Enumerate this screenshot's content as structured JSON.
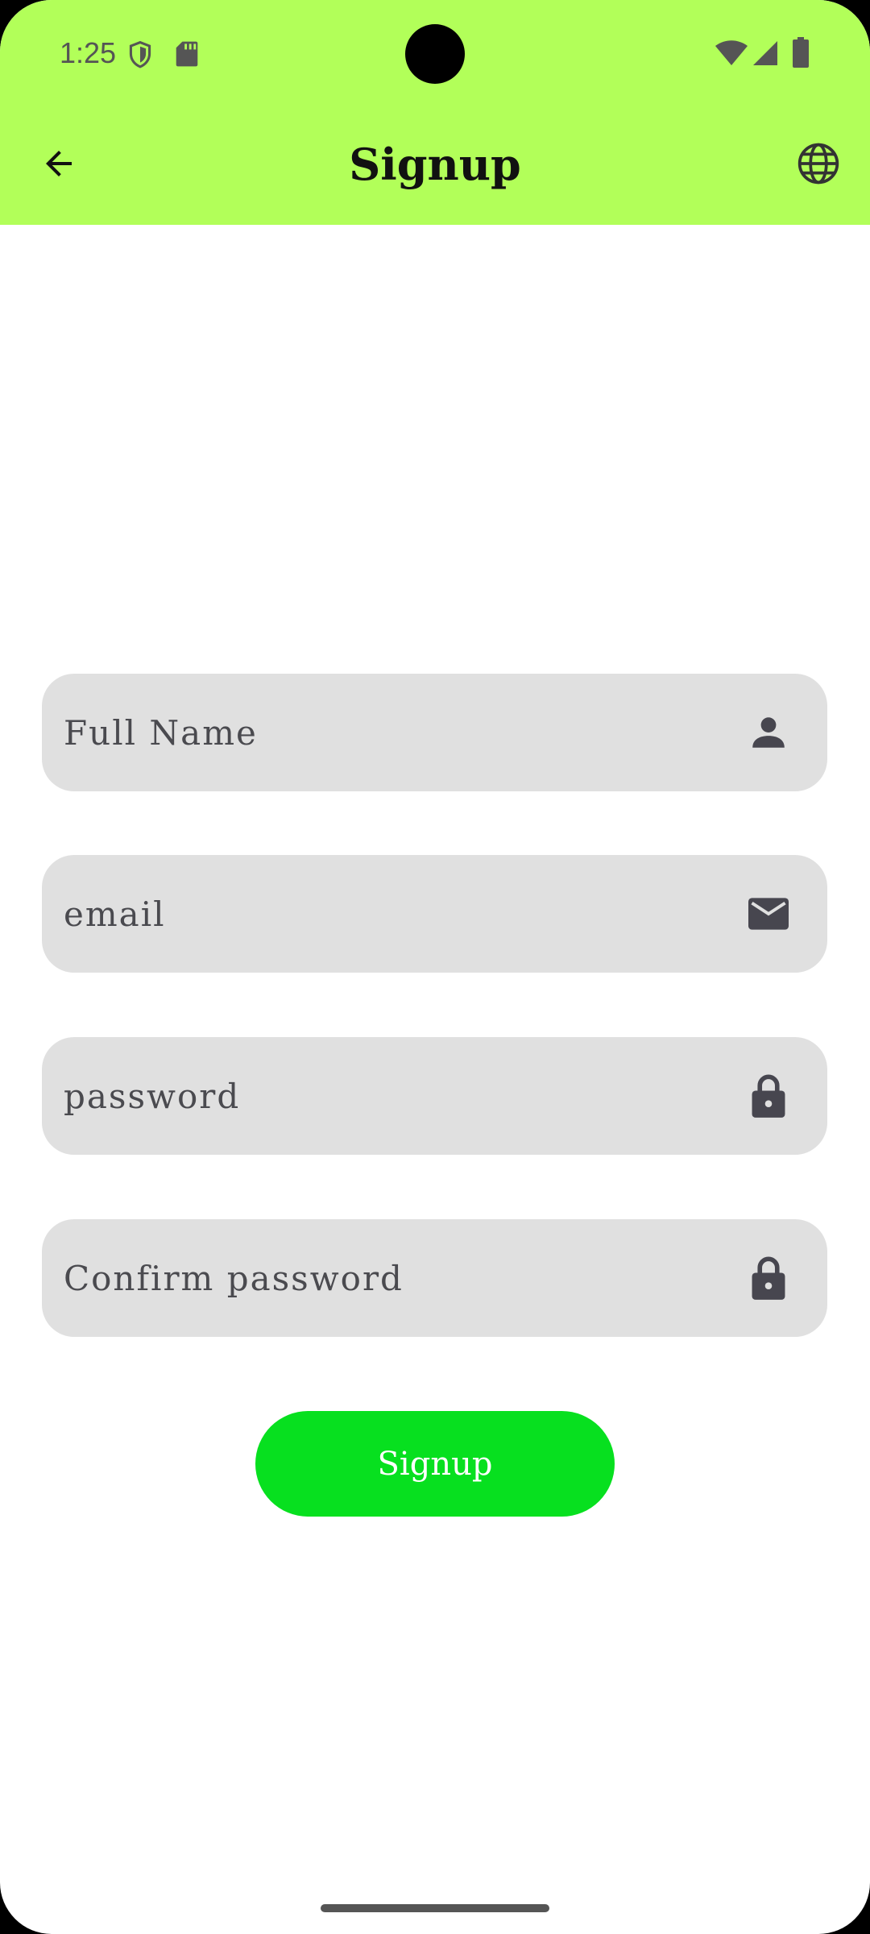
{
  "status_bar": {
    "time": "1:25"
  },
  "toolbar": {
    "title": "Signup",
    "back_icon": "arrow-back-icon",
    "language_icon": "globe-icon"
  },
  "form": {
    "full_name": {
      "placeholder": "Full Name",
      "value": "",
      "icon": "person-icon"
    },
    "email": {
      "placeholder": "email",
      "value": "",
      "icon": "mail-icon"
    },
    "password": {
      "placeholder": "password",
      "value": "",
      "icon": "lock-icon"
    },
    "confirm_password": {
      "placeholder": "Confirm password",
      "value": "",
      "icon": "lock-icon"
    }
  },
  "signup_button": {
    "label": "Signup"
  },
  "colors": {
    "app_bar": "#b2ff59",
    "primary_button": "#07e01f",
    "field_background": "#e0e0e0",
    "icon": "#47464f"
  }
}
